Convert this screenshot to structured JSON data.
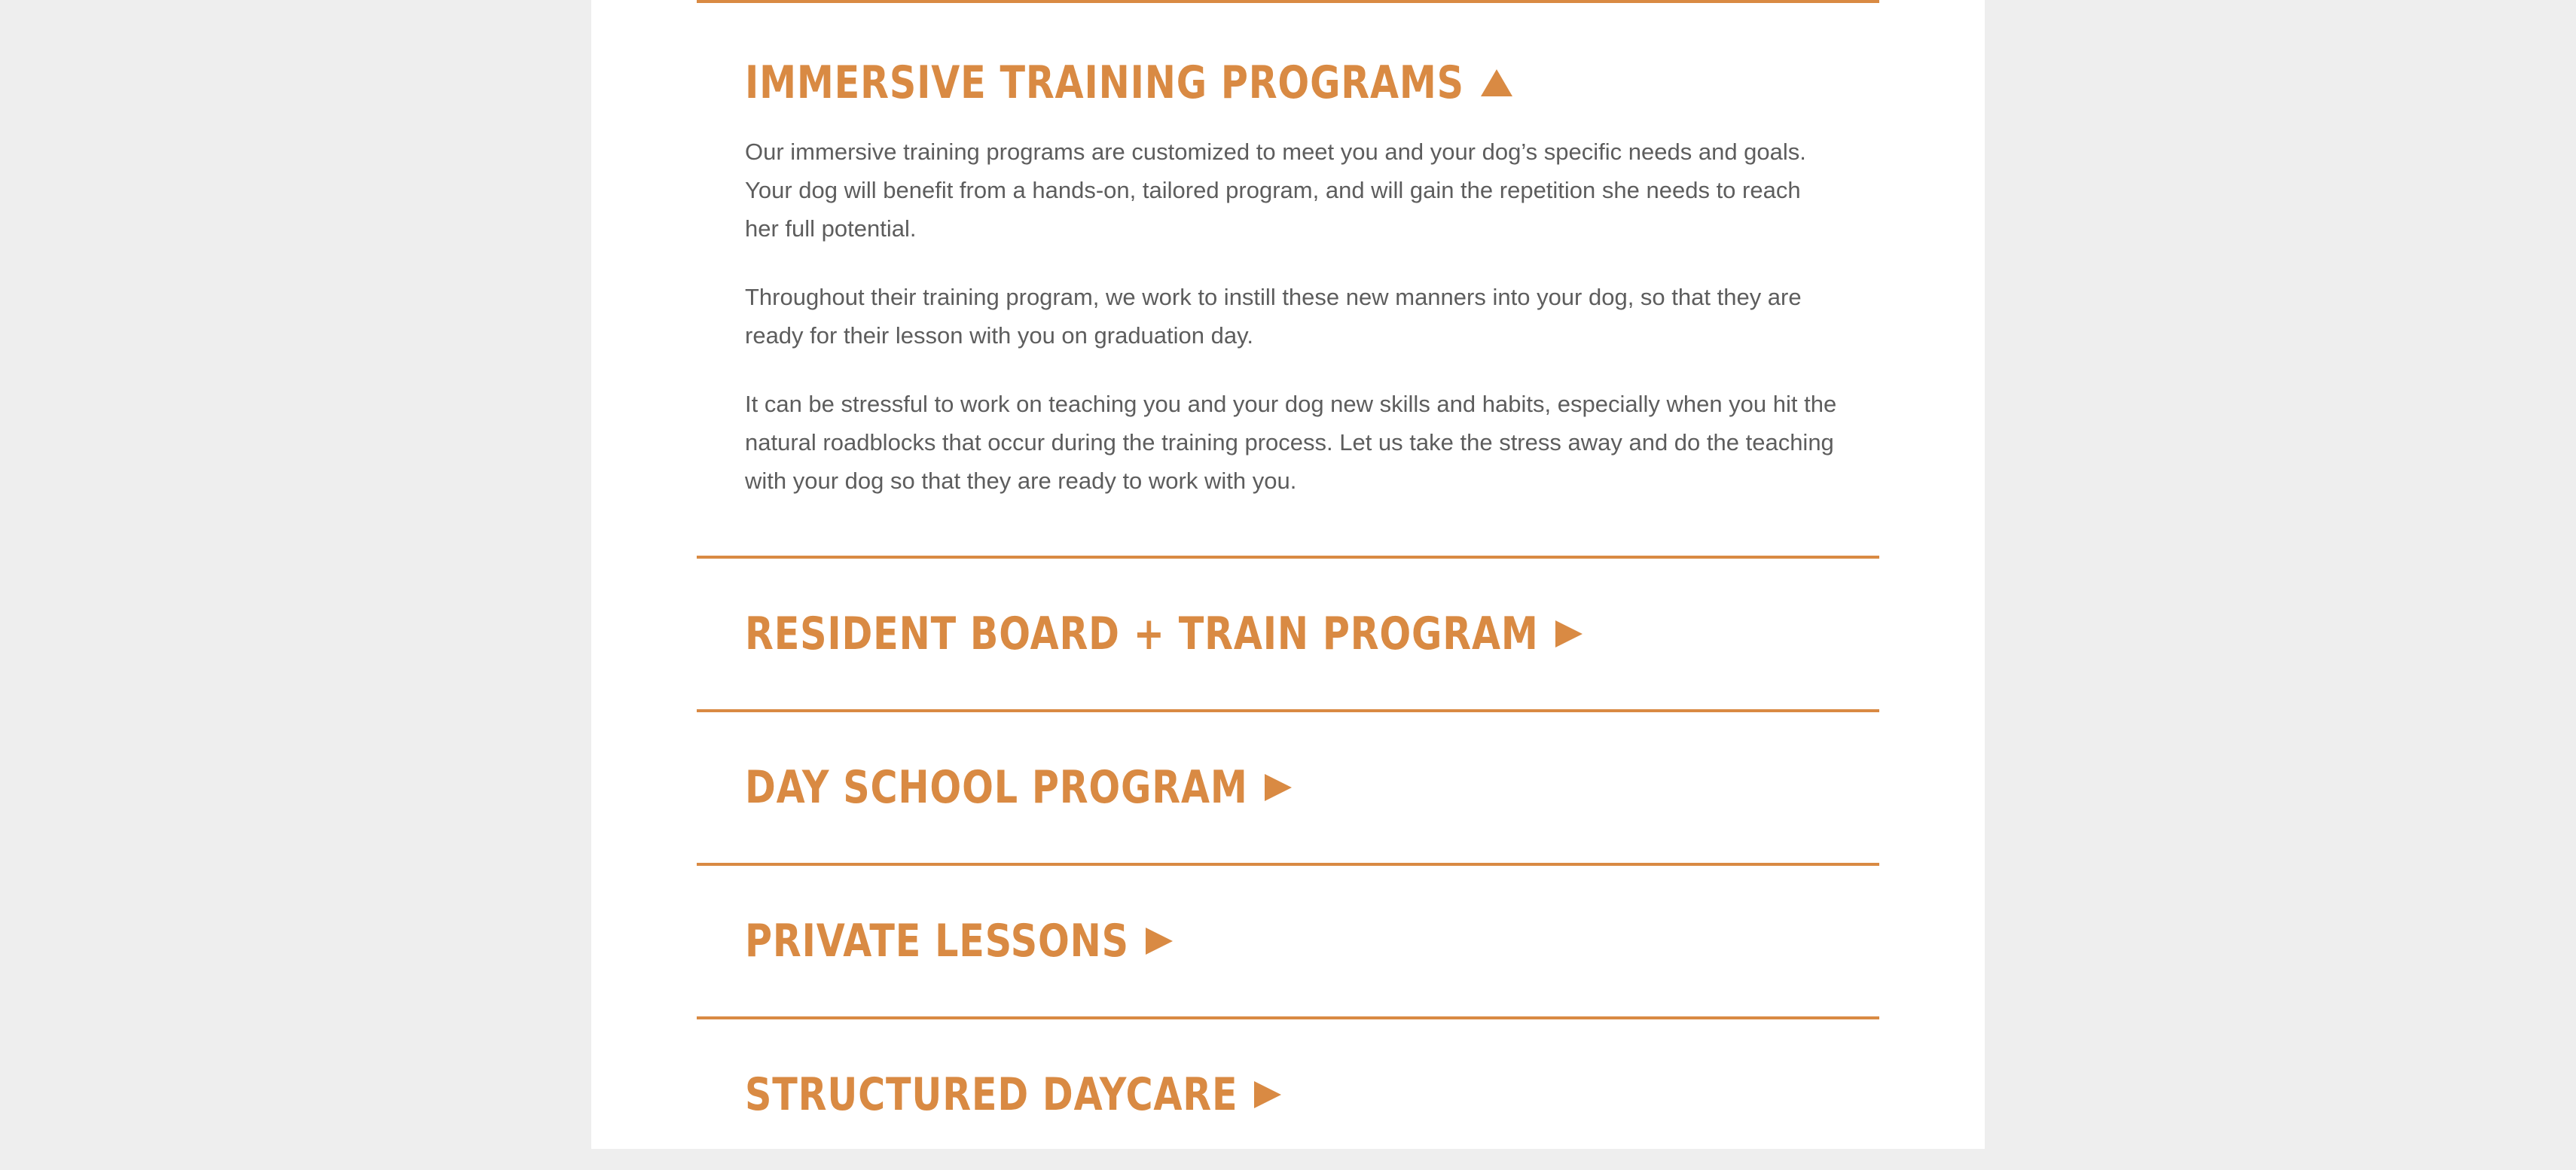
{
  "accent_color": "#d98a43",
  "sections": [
    {
      "title": "IMMERSIVE TRAINING PROGRAMS",
      "expanded": true,
      "arrow_icon": "triangle-up-icon",
      "paragraphs": [
        "Our immersive training programs are customized to meet you and your dog’s specific needs and goals. Your dog will benefit from a hands-on, tailored program, and will gain the repetition she needs to reach her full potential.",
        "Throughout their training program, we work to instill these new manners into your dog, so that they are ready for their lesson with you on graduation day.",
        "It can be stressful to work on teaching you and your dog new skills and habits, especially when you hit the natural roadblocks that occur during the training process. Let us take the stress away and do the teaching with your dog so that they are ready to work with you."
      ]
    },
    {
      "title": "RESIDENT BOARD + TRAIN PROGRAM",
      "expanded": false,
      "arrow_icon": "triangle-right-icon"
    },
    {
      "title": "DAY SCHOOL PROGRAM",
      "expanded": false,
      "arrow_icon": "triangle-right-icon"
    },
    {
      "title": "PRIVATE LESSONS",
      "expanded": false,
      "arrow_icon": "triangle-right-icon"
    },
    {
      "title": "STRUCTURED DAYCARE",
      "expanded": false,
      "arrow_icon": "triangle-right-icon"
    }
  ]
}
